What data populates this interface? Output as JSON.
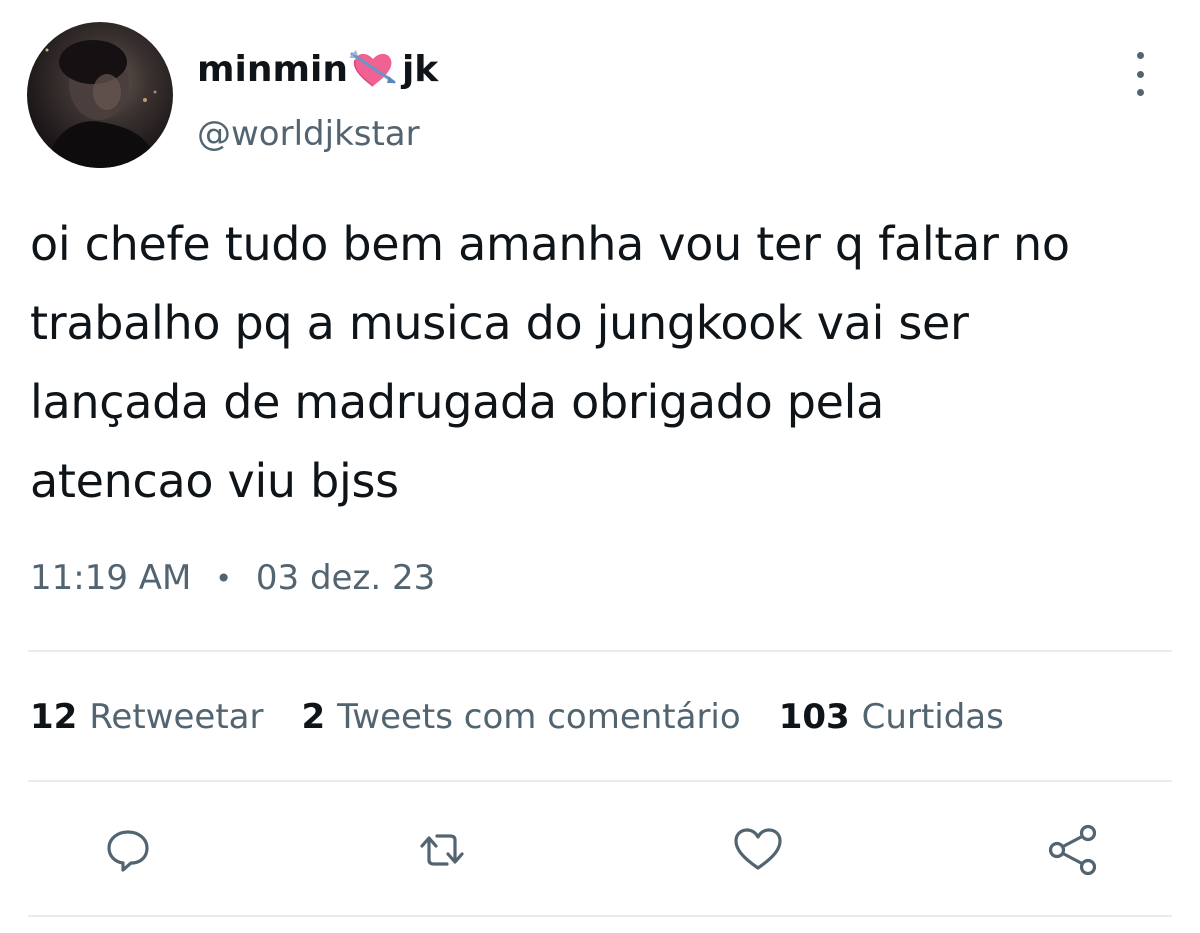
{
  "tweet": {
    "display_name_prefix": "minmin",
    "display_name_suffix": "jk",
    "name_emoji": "heart-with-arrow-emoji",
    "handle": "@worldjkstar",
    "text_lines": [
      "oi chefe tudo bem amanha vou ter q faltar no",
      "trabalho pq a musica do jungkook vai ser",
      "lançada de madrugada obrigado pela",
      "atencao viu bjss"
    ],
    "time": "11:19 AM",
    "separator": "•",
    "date": "03 dez. 23"
  },
  "stats": {
    "retweets_count": "12",
    "retweets_label": "Retweetar",
    "quotes_count": "2",
    "quotes_label": "Tweets com comentário",
    "likes_count": "103",
    "likes_label": "Curtidas"
  },
  "actions": [
    "reply-icon",
    "retweet-icon",
    "like-icon",
    "share-icon"
  ],
  "colors": {
    "text_primary": "#0f1419",
    "text_secondary": "#536471",
    "divider": "#e6ecf0",
    "emoji_heart": "#f06292"
  }
}
